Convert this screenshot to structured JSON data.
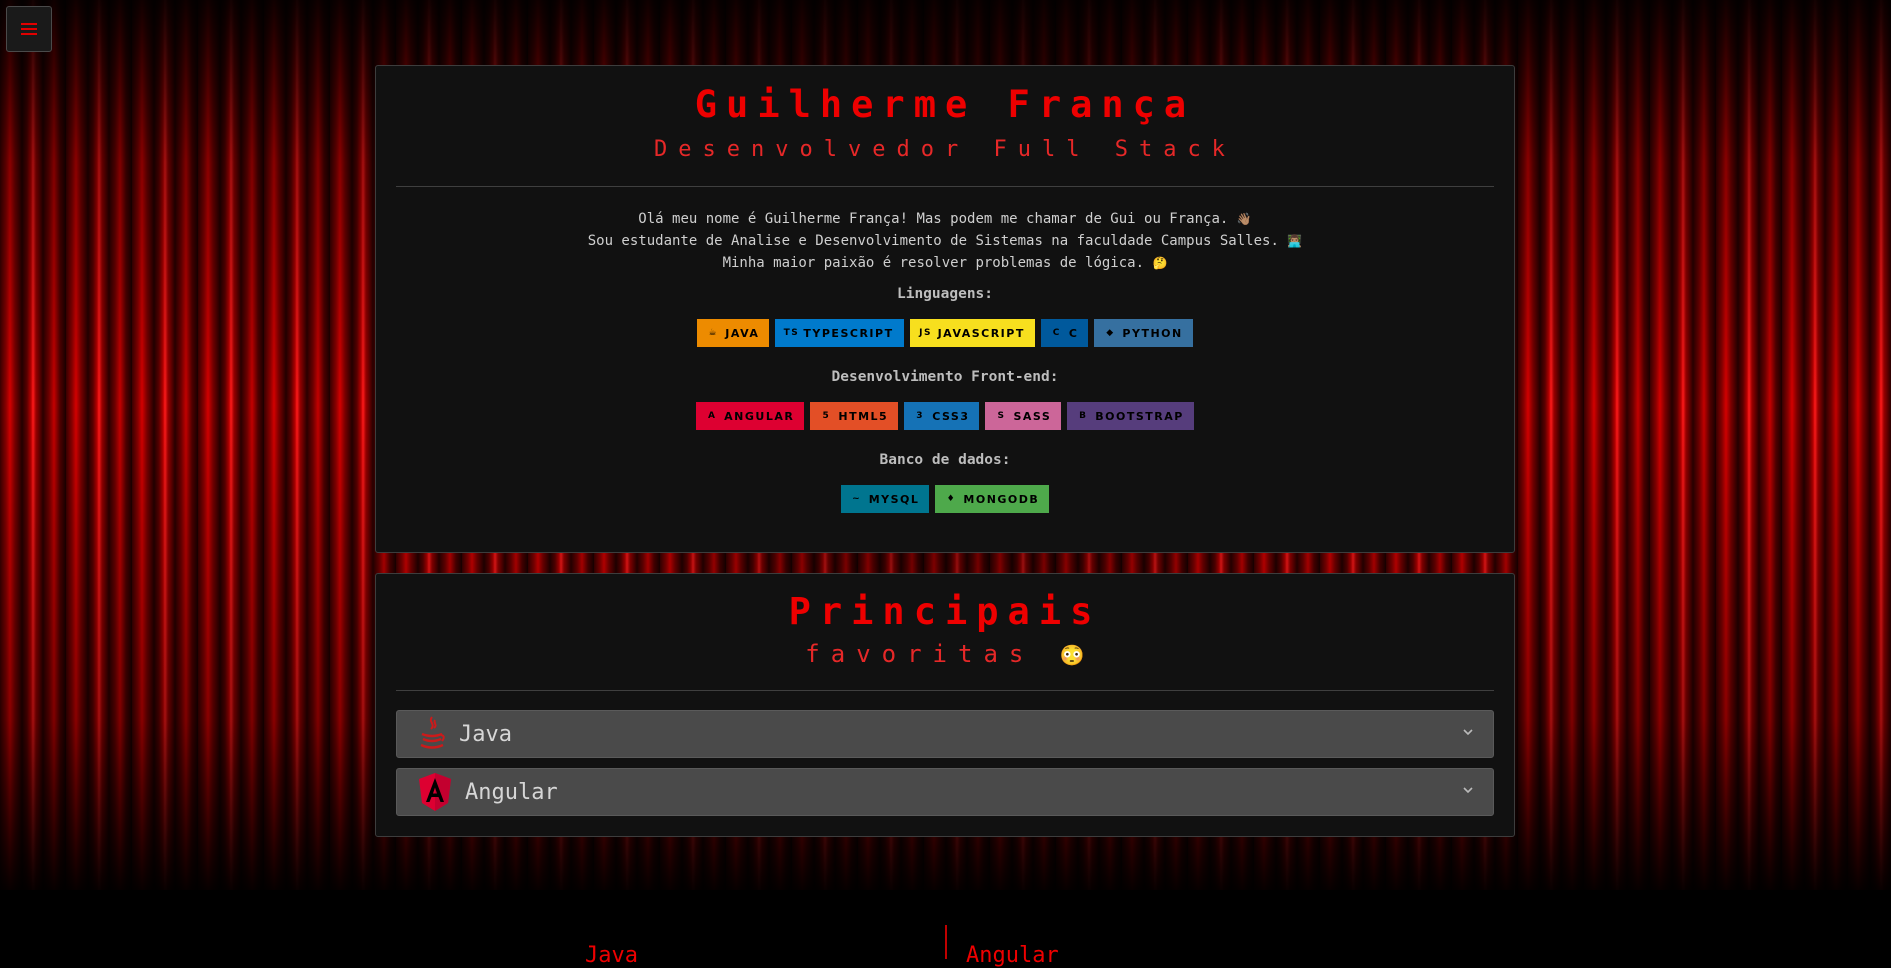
{
  "header": {
    "menu_icon": "hamburger-icon"
  },
  "profile": {
    "name": "Guilherme França",
    "role": "Desenvolvedor Full Stack",
    "bio_lines": [
      "Olá meu nome é Guilherme França! Mas podem me chamar de Gui ou França.",
      "Sou estudante de Analise e Desenvolvimento de Sistemas na faculdade Campus Salles.",
      "Minha maior paixão é resolver problemas de lógica."
    ],
    "bio_emojis": [
      "👋🏽",
      "👨🏽‍💻",
      "🤔"
    ],
    "sections": {
      "languages": {
        "title": "Linguagens:",
        "badges": [
          {
            "label": "JAVA",
            "icon": "java-icon",
            "bg": "#ED8B00",
            "fg": "#000000"
          },
          {
            "label": "TYPESCRIPT",
            "icon": "typescript-icon",
            "bg": "#007ACC",
            "fg": "#000000"
          },
          {
            "label": "JAVASCRIPT",
            "icon": "javascript-icon",
            "bg": "#F7DF1E",
            "fg": "#000000"
          },
          {
            "label": "C",
            "icon": "c-icon",
            "bg": "#00599C",
            "fg": "#000000"
          },
          {
            "label": "PYTHON",
            "icon": "python-icon",
            "bg": "#3670A0",
            "fg": "#000000"
          }
        ]
      },
      "frontend": {
        "title": "Desenvolvimento Front-end:",
        "badges": [
          {
            "label": "ANGULAR",
            "icon": "angular-icon",
            "bg": "#DD0031",
            "fg": "#000000"
          },
          {
            "label": "HTML5",
            "icon": "html5-icon",
            "bg": "#E34F26",
            "fg": "#000000"
          },
          {
            "label": "CSS3",
            "icon": "css3-icon",
            "bg": "#1572B6",
            "fg": "#000000"
          },
          {
            "label": "SASS",
            "icon": "sass-icon",
            "bg": "#CC6699",
            "fg": "#000000"
          },
          {
            "label": "BOOTSTRAP",
            "icon": "bootstrap-icon",
            "bg": "#563D7C",
            "fg": "#000000"
          }
        ]
      },
      "databases": {
        "title": "Banco de dados:",
        "badges": [
          {
            "label": "MYSQL",
            "icon": "mysql-icon",
            "bg": "#00758F",
            "fg": "#000000"
          },
          {
            "label": "MONGODB",
            "icon": "mongodb-icon",
            "bg": "#4EA94B",
            "fg": "#000000"
          }
        ]
      }
    }
  },
  "favorites": {
    "title": "Principais",
    "subtitle": "favoritas",
    "emoji": "😳",
    "items": [
      {
        "label": "Java",
        "icon": "java-icon"
      },
      {
        "label": "Angular",
        "icon": "angular-icon"
      }
    ]
  },
  "footer": {
    "left": "Java",
    "right": "Angular"
  },
  "colors": {
    "accent": "#EE0000",
    "card_bg": "#111111",
    "accordion_bg": "#4A4A4A"
  }
}
